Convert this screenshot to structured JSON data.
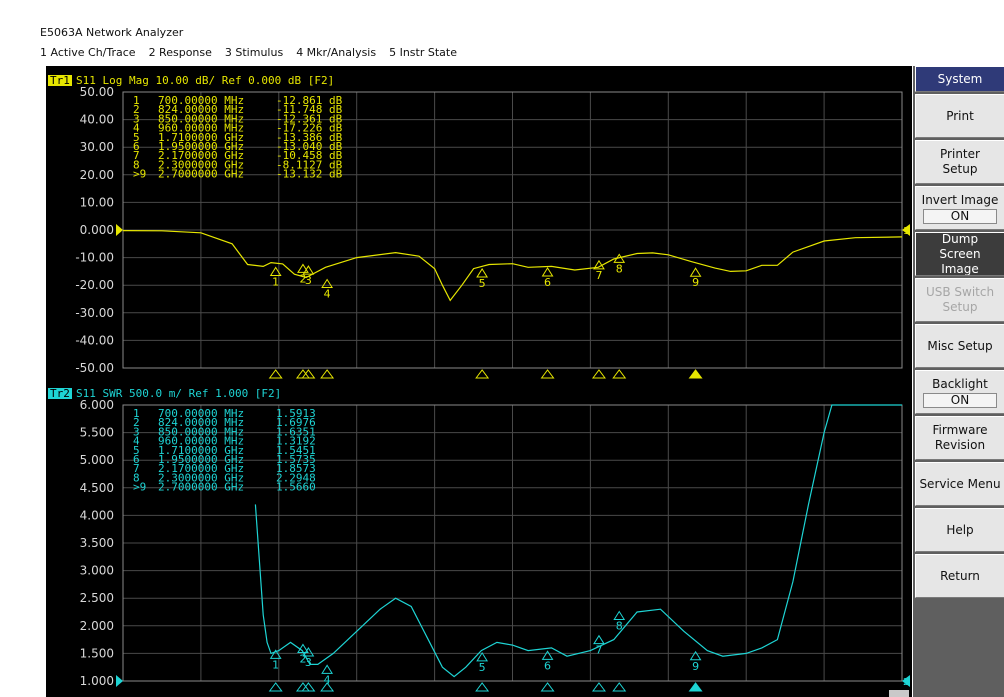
{
  "window": {
    "title": "E5063A Network Analyzer"
  },
  "menu": [
    "1 Active Ch/Trace",
    "2 Response",
    "3 Stimulus",
    "4 Mkr/Analysis",
    "5 Instr State"
  ],
  "colors": {
    "trace1": "#e6e600",
    "trace2": "#1ed4d4",
    "grid": "#4a4a4a",
    "background": "#000000",
    "softkey_header": "#2f3a78"
  },
  "trace1": {
    "tag": "Tr1",
    "header": "S11  Log Mag 10.00 dB/ Ref 0.000 dB [F2]",
    "ref_marker": "1",
    "y_ticks": [
      "50.00",
      "40.00",
      "30.00",
      "20.00",
      "10.00",
      "0.000",
      "-10.00",
      "-20.00",
      "-30.00",
      "-40.00",
      "-50.00"
    ],
    "markers": [
      {
        "n": "1",
        "freq": "700.00000 MHz",
        "value": "-12.861 dB"
      },
      {
        "n": "2",
        "freq": "824.00000 MHz",
        "value": "-11.748 dB"
      },
      {
        "n": "3",
        "freq": "850.00000 MHz",
        "value": "-12.361 dB"
      },
      {
        "n": "4",
        "freq": "960.00000 MHz",
        "value": "-17.226 dB"
      },
      {
        "n": "5",
        "freq": "1.7100000 GHz",
        "value": "-13.386 dB"
      },
      {
        "n": "6",
        "freq": "1.9500000 GHz",
        "value": "-13.040 dB"
      },
      {
        "n": "7",
        "freq": "2.1700000 GHz",
        "value": "-10.458 dB"
      },
      {
        "n": "8",
        "freq": "2.3000000 GHz",
        "value": "-8.1127 dB"
      },
      {
        "n": ">9",
        "freq": "2.7000000 GHz",
        "value": "-13.132 dB"
      }
    ],
    "marker_labels": [
      "1",
      "2",
      "3",
      "4",
      "5",
      "6",
      "7",
      "8",
      "9"
    ],
    "curve": [
      [
        0,
        -0.2
      ],
      [
        0.05,
        -0.3
      ],
      [
        0.1,
        -1
      ],
      [
        0.14,
        -5
      ],
      [
        0.16,
        -12.5
      ],
      [
        0.18,
        -13.2
      ],
      [
        0.19,
        -11.8
      ],
      [
        0.205,
        -12.3
      ],
      [
        0.22,
        -16
      ],
      [
        0.235,
        -17.2
      ],
      [
        0.26,
        -13.5
      ],
      [
        0.3,
        -10
      ],
      [
        0.35,
        -8.2
      ],
      [
        0.38,
        -9.5
      ],
      [
        0.4,
        -14
      ],
      [
        0.41,
        -20
      ],
      [
        0.42,
        -25.5
      ],
      [
        0.435,
        -20
      ],
      [
        0.45,
        -14
      ],
      [
        0.47,
        -12.5
      ],
      [
        0.5,
        -12.2
      ],
      [
        0.52,
        -13.5
      ],
      [
        0.55,
        -13.2
      ],
      [
        0.58,
        -14.5
      ],
      [
        0.61,
        -13.5
      ],
      [
        0.63,
        -10.5
      ],
      [
        0.66,
        -8.5
      ],
      [
        0.68,
        -8.3
      ],
      [
        0.7,
        -9
      ],
      [
        0.73,
        -11.5
      ],
      [
        0.76,
        -13.8
      ],
      [
        0.78,
        -15
      ],
      [
        0.8,
        -14.8
      ],
      [
        0.82,
        -12.8
      ],
      [
        0.84,
        -12.8
      ],
      [
        0.86,
        -8
      ],
      [
        0.9,
        -4
      ],
      [
        0.94,
        -2.8
      ],
      [
        1.0,
        -2.5
      ]
    ]
  },
  "trace2": {
    "tag": "Tr2",
    "header": "S11  SWR 500.0 m/ Ref 1.000  [F2]",
    "ref_marker": "2",
    "y_ticks": [
      "6.000",
      "5.500",
      "5.000",
      "4.500",
      "4.000",
      "3.500",
      "3.000",
      "2.500",
      "2.000",
      "1.500",
      "1.000"
    ],
    "markers": [
      {
        "n": "1",
        "freq": "700.00000 MHz",
        "value": "1.5913"
      },
      {
        "n": "2",
        "freq": "824.00000 MHz",
        "value": "1.6976"
      },
      {
        "n": "3",
        "freq": "850.00000 MHz",
        "value": "1.6351"
      },
      {
        "n": "4",
        "freq": "960.00000 MHz",
        "value": "1.3192"
      },
      {
        "n": "5",
        "freq": "1.7100000 GHz",
        "value": "1.5451"
      },
      {
        "n": "6",
        "freq": "1.9500000 GHz",
        "value": "1.5735"
      },
      {
        "n": "7",
        "freq": "2.1700000 GHz",
        "value": "1.8573"
      },
      {
        "n": "8",
        "freq": "2.3000000 GHz",
        "value": "2.2948"
      },
      {
        "n": ">9",
        "freq": "2.7000000 GHz",
        "value": "1.5660"
      }
    ],
    "marker_labels": [
      "1",
      "2",
      "3",
      "4",
      "5",
      "6",
      "7",
      "8",
      "9"
    ],
    "curve": [
      [
        0.17,
        4.2
      ],
      [
        0.175,
        3.2
      ],
      [
        0.18,
        2.2
      ],
      [
        0.185,
        1.7
      ],
      [
        0.19,
        1.5
      ],
      [
        0.2,
        1.55
      ],
      [
        0.215,
        1.7
      ],
      [
        0.23,
        1.55
      ],
      [
        0.24,
        1.3
      ],
      [
        0.25,
        1.3
      ],
      [
        0.27,
        1.5
      ],
      [
        0.3,
        1.9
      ],
      [
        0.33,
        2.3
      ],
      [
        0.35,
        2.5
      ],
      [
        0.37,
        2.35
      ],
      [
        0.39,
        1.8
      ],
      [
        0.41,
        1.25
      ],
      [
        0.425,
        1.08
      ],
      [
        0.44,
        1.25
      ],
      [
        0.46,
        1.55
      ],
      [
        0.48,
        1.7
      ],
      [
        0.5,
        1.65
      ],
      [
        0.52,
        1.55
      ],
      [
        0.55,
        1.6
      ],
      [
        0.57,
        1.45
      ],
      [
        0.6,
        1.55
      ],
      [
        0.63,
        1.75
      ],
      [
        0.66,
        2.25
      ],
      [
        0.69,
        2.3
      ],
      [
        0.72,
        1.9
      ],
      [
        0.75,
        1.55
      ],
      [
        0.77,
        1.45
      ],
      [
        0.8,
        1.5
      ],
      [
        0.82,
        1.6
      ],
      [
        0.84,
        1.75
      ],
      [
        0.86,
        2.8
      ],
      [
        0.88,
        4.2
      ],
      [
        0.9,
        5.5
      ],
      [
        0.91,
        6.05
      ],
      [
        0.93,
        6.05
      ],
      [
        1.0,
        6.05
      ]
    ]
  },
  "marker_positions": [
    0.196,
    0.231,
    0.238,
    0.262,
    0.461,
    0.545,
    0.611,
    0.637,
    0.735
  ],
  "softkeys": [
    {
      "label": "System",
      "type": "header"
    },
    {
      "label": "Print"
    },
    {
      "label": "Printer Setup"
    },
    {
      "label": "Invert Image",
      "value": "ON"
    },
    {
      "label": "Dump Screen Image",
      "type": "dark"
    },
    {
      "label": "USB Switch Setup",
      "type": "disabled"
    },
    {
      "label": "Misc Setup"
    },
    {
      "label": "Backlight",
      "value": "ON"
    },
    {
      "label": "Firmware Revision"
    },
    {
      "label": "Service Menu"
    },
    {
      "label": "Help"
    },
    {
      "label": "Return"
    }
  ]
}
